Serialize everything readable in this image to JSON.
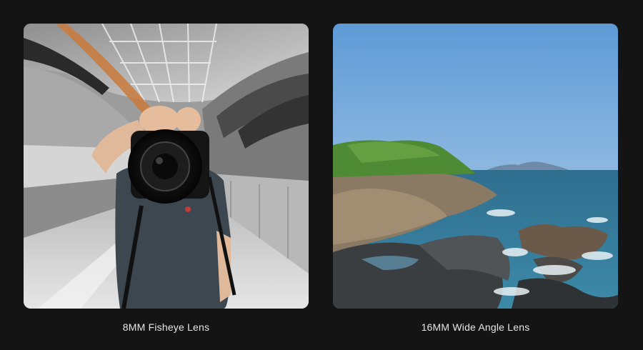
{
  "panels": [
    {
      "caption": "8MM Fisheye Lens"
    },
    {
      "caption": "16MM Wide Angle Lens"
    }
  ],
  "colors": {
    "background": "#141414",
    "caption_text": "#e6e6e6",
    "sky": "#7fb2e0",
    "sea": "#2f6e8f",
    "foliage": "#5a8d3c"
  }
}
